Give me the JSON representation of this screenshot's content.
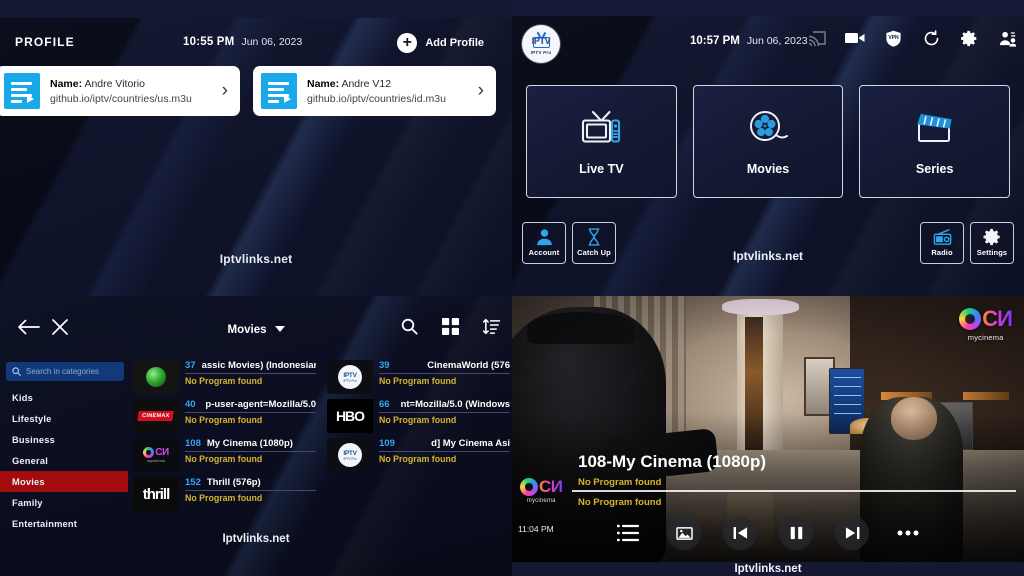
{
  "profile_panel": {
    "title": "PROFILE",
    "time": "10:55 PM",
    "date": "Jun 06, 2023",
    "add_profile_label": "Add Profile",
    "plus_glyph": "+",
    "name_label": "Name:",
    "chevron_glyph": "›",
    "profiles": [
      {
        "name": "Andre Vitorio",
        "url": "github.io/iptv/countries/us.m3u"
      },
      {
        "name": "Andre V12",
        "url": "github.io/iptv/countries/id.m3u"
      }
    ],
    "watermark": "Iptvlinks.net"
  },
  "home_panel": {
    "logo_word": "IPTV",
    "logo_sub": "IPTV Pro",
    "time": "10:57 PM",
    "date": "Jun 06, 2023",
    "header_icons": [
      {
        "name": "cast-icon"
      },
      {
        "name": "video-recorder-icon"
      },
      {
        "name": "vpn-shield-icon",
        "label": "VPN"
      },
      {
        "name": "refresh-icon"
      },
      {
        "name": "gear-icon"
      },
      {
        "name": "switch-user-icon"
      }
    ],
    "tiles": [
      {
        "label": "Live TV",
        "icon": "tv-icon"
      },
      {
        "label": "Movies",
        "icon": "film-reel-icon"
      },
      {
        "label": "Series",
        "icon": "clapperboard-icon"
      }
    ],
    "buttons": [
      {
        "label": "Account",
        "icon": "user-icon"
      },
      {
        "label": "Catch Up",
        "icon": "hourglass-icon"
      },
      {
        "label": "Radio",
        "icon": "radio-icon"
      },
      {
        "label": "Settings",
        "icon": "gear-icon"
      }
    ],
    "watermark": "Iptvlinks.net"
  },
  "list_panel": {
    "title": "Movies",
    "back_glyph": "←",
    "close_glyph": "✕",
    "search_placeholder": "Search in categories",
    "tools": [
      {
        "name": "search-icon"
      },
      {
        "name": "grid-view-icon"
      },
      {
        "name": "sort-icon"
      }
    ],
    "categories": [
      {
        "label": "Kids",
        "active": false
      },
      {
        "label": "Lifestyle",
        "active": false
      },
      {
        "label": "Business",
        "active": false
      },
      {
        "label": "General",
        "active": false
      },
      {
        "label": "Movies",
        "active": true
      },
      {
        "label": "Family",
        "active": false
      },
      {
        "label": "Entertainment",
        "active": false
      }
    ],
    "no_program_text": "No Program found",
    "channels_left": [
      {
        "number": "37",
        "name": "assic Movies) (Indonesian",
        "logo": "green-globe-logo"
      },
      {
        "number": "40",
        "name": "p-user-agent=Mozilla/5.0",
        "logo": "cinemax-logo"
      },
      {
        "number": "108",
        "name": "My Cinema (1080p)",
        "logo": "mycinema-logo"
      },
      {
        "number": "152",
        "name": "Thrill (576p)",
        "logo": "thrill-logo"
      }
    ],
    "channels_right": [
      {
        "number": "39",
        "name": "CinemaWorld (576",
        "logo": "iptv-pro-logo"
      },
      {
        "number": "66",
        "name": "nt=Mozilla/5.0 (Windows",
        "logo": "hbo-logo"
      },
      {
        "number": "109",
        "name": "d]           My Cinema Asi",
        "logo": "iptv-pro-logo"
      }
    ],
    "watermark": "Iptvlinks.net"
  },
  "player_panel": {
    "channel_title": "108-My Cinema (1080p)",
    "now_playing": "No Program found",
    "next_playing": "No Program found",
    "clock": "11:04 PM",
    "watermark": "Iptvlinks.net",
    "brand_mark": "CИ",
    "brand_sub": "mycinema",
    "controls": [
      {
        "name": "playlist-icon"
      },
      {
        "name": "aspect-ratio-icon"
      },
      {
        "name": "previous-channel-icon"
      },
      {
        "name": "pause-icon"
      },
      {
        "name": "next-channel-icon"
      },
      {
        "name": "more-options-icon"
      }
    ]
  },
  "colors": {
    "accent_blue": "#1aa9e8",
    "active_red": "#a30c0c",
    "epg_yellow": "#d5b52e",
    "channel_number": "#39a4f0"
  }
}
